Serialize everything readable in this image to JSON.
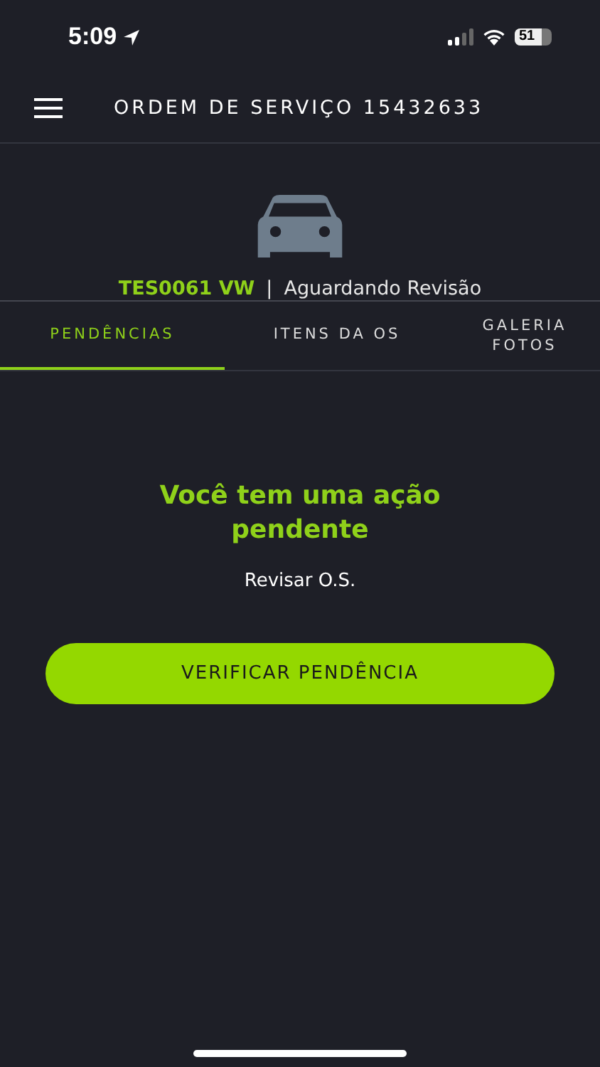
{
  "status_bar": {
    "time": "5:09",
    "battery": "51"
  },
  "header": {
    "title": "ORDEM DE SERVIÇO 15432633"
  },
  "vehicle": {
    "plate": "TES0061 VW",
    "separator": "|",
    "status": "Aguardando Revisão"
  },
  "tabs": [
    {
      "label": "PENDÊNCIAS",
      "selected": true
    },
    {
      "label": "ITENS DA OS",
      "selected": false
    },
    {
      "label": "GALERIA FOTOS",
      "selected": false
    }
  ],
  "pending": {
    "heading": "Você tem uma ação pendente",
    "action": "Revisar O.S.",
    "button": "VERIFICAR PENDÊNCIA"
  }
}
